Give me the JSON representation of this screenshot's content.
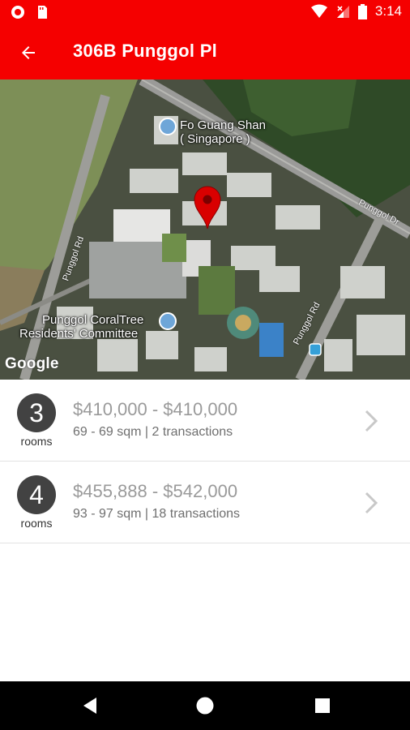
{
  "status_bar": {
    "time": "3:14",
    "icons": [
      "notification-icon",
      "sd-card-icon",
      "wifi-icon",
      "signal-icon",
      "battery-icon"
    ]
  },
  "app_bar": {
    "title": "306B Punggol Pl",
    "back_icon": "arrow-left-icon",
    "color": "#f50000"
  },
  "map": {
    "labels": {
      "poi_1": "Fo Guang Shan",
      "poi_1_sub": "( Singapore )",
      "poi_2": "Punggol CoralTree",
      "poi_2_sub": "Residents' Committee",
      "road_1": "Punggol Rd",
      "road_2": "Punggol Rd",
      "road_3": "Punggol Dr"
    },
    "logo": "Google",
    "marker_color": "#d90000"
  },
  "listings": [
    {
      "rooms": "3",
      "rooms_label": "rooms",
      "price_range": "$410,000 - $410,000",
      "details": "69 - 69 sqm | 2 transactions"
    },
    {
      "rooms": "4",
      "rooms_label": "rooms",
      "price_range": "$455,888 - $542,000",
      "details": "93 - 97 sqm | 18 transactions"
    }
  ],
  "nav_bar": {
    "buttons": [
      "back-triangle-icon",
      "home-circle-icon",
      "recents-square-icon"
    ]
  }
}
